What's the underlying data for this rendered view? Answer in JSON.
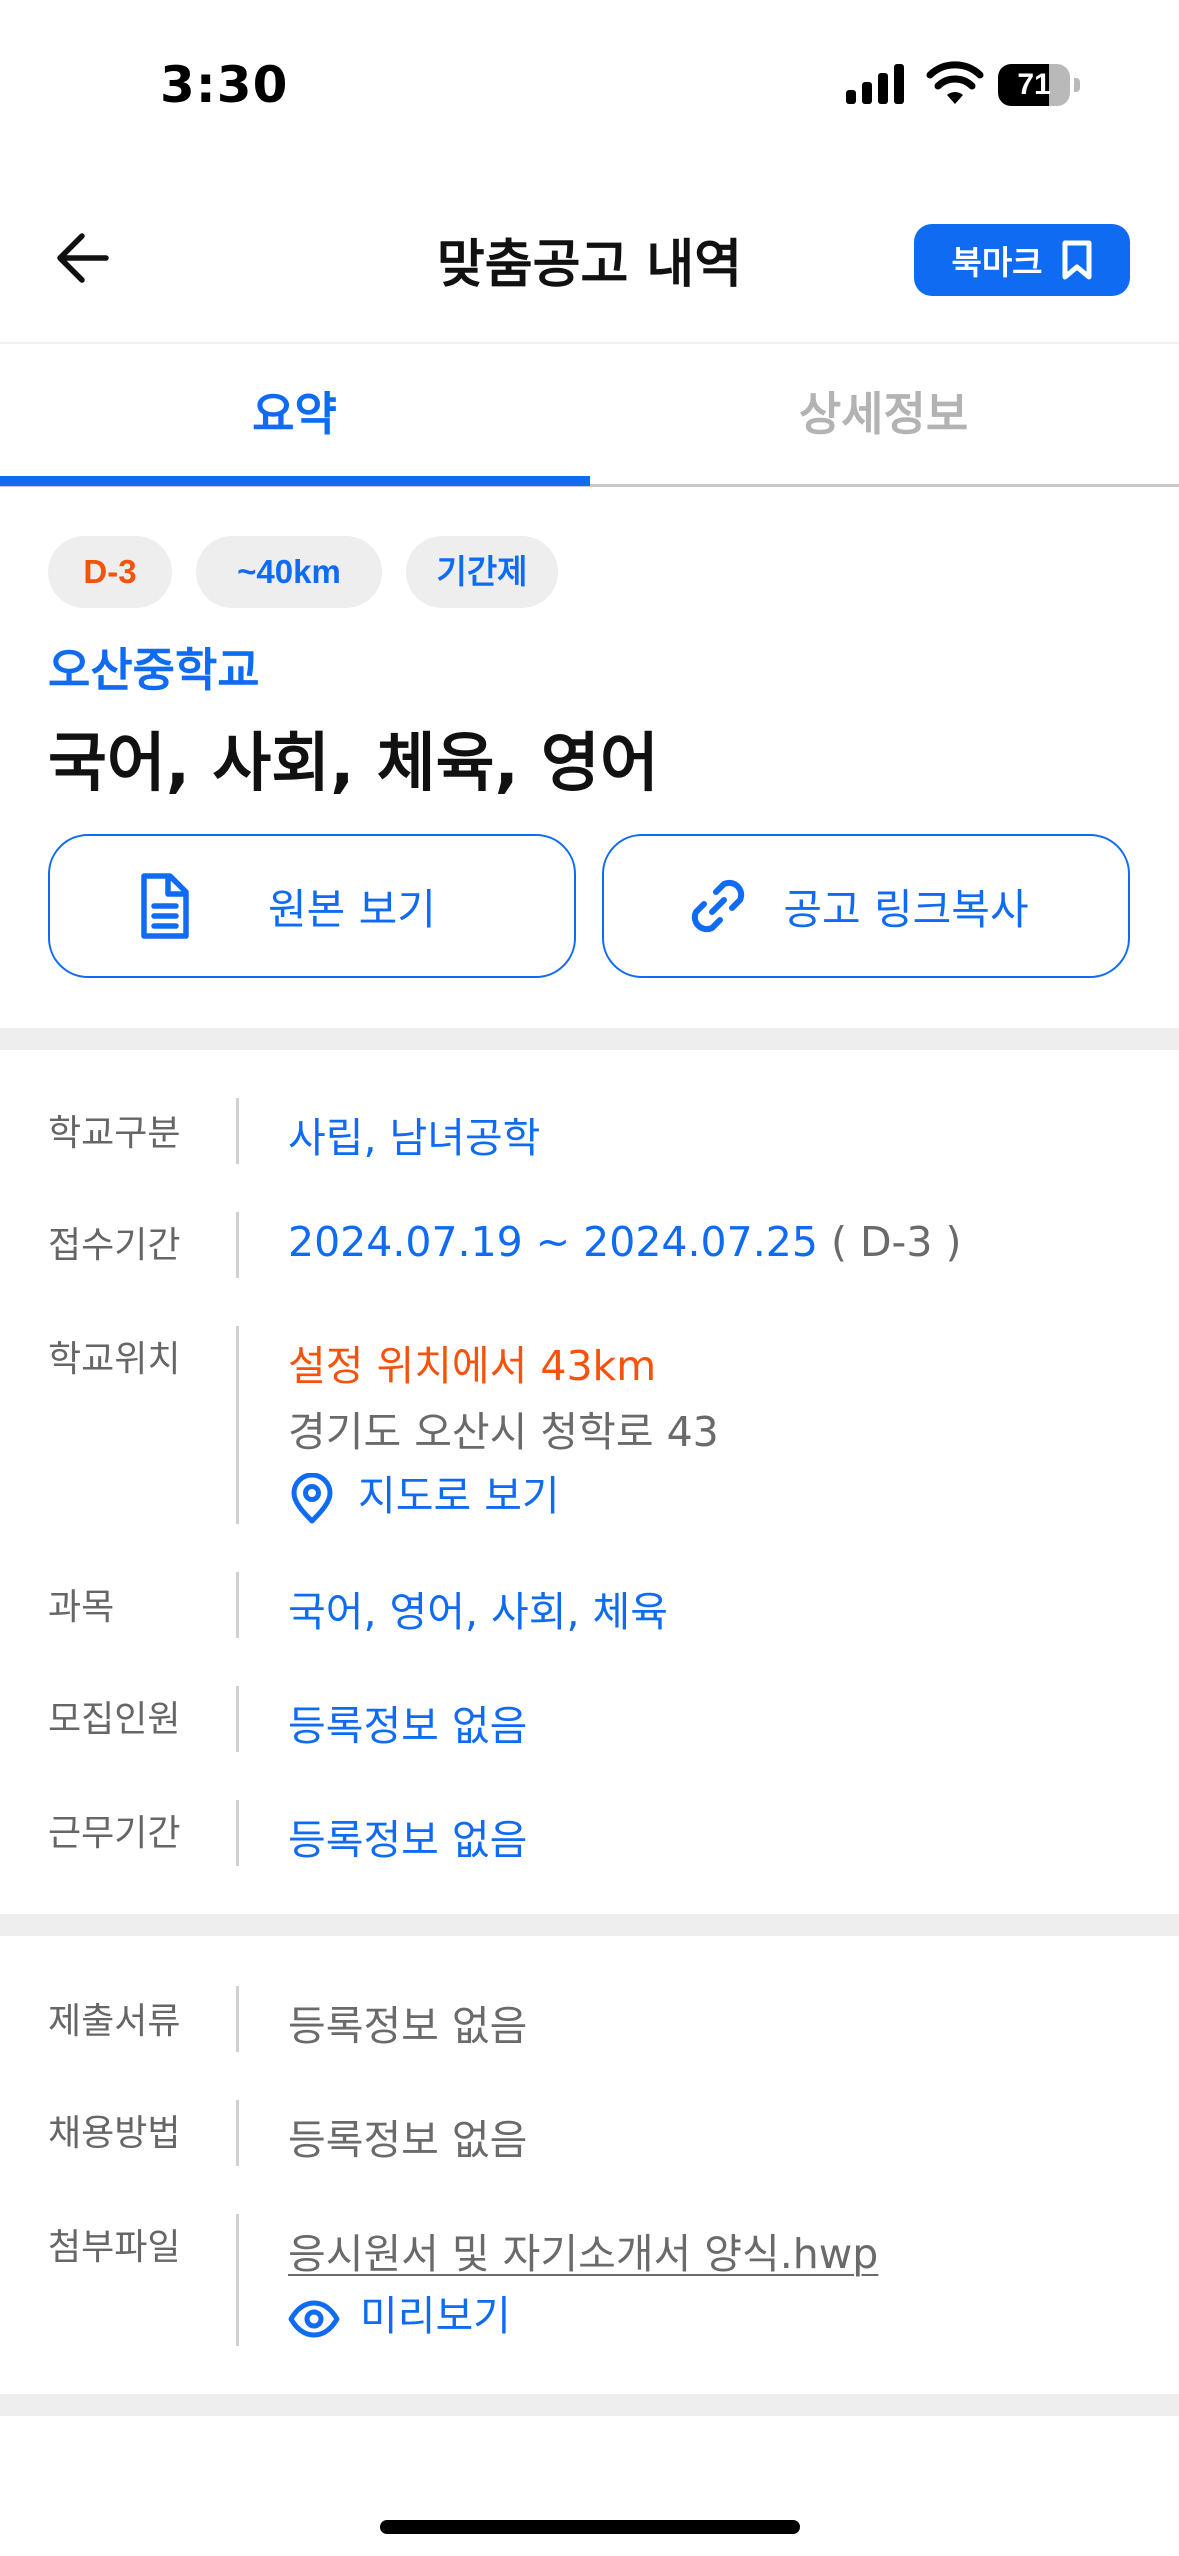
{
  "status_bar": {
    "time": "3:30",
    "battery": "71",
    "battery_level": 0.71
  },
  "header": {
    "title": "맞춤공고 내역",
    "bookmark_label": "북마크"
  },
  "tabs": [
    {
      "label": "요약",
      "active": true
    },
    {
      "label": "상세정보",
      "active": false
    }
  ],
  "chips": {
    "deadline": "D-3",
    "distance": "~40km",
    "type": "기간제"
  },
  "school_name": "오산중학교",
  "subjects_title": "국어, 사회, 체육, 영어",
  "actions": {
    "original": "원본 보기",
    "copy_link": "공고 링크복사"
  },
  "info": {
    "school_type_label": "학교구분",
    "school_type": "사립, 남녀공학",
    "period_label": "접수기간",
    "period": "2024.07.19 ~ 2024.07.25",
    "period_dday": " ( D-3 )",
    "location_label": "학교위치",
    "location_distance": "설정 위치에서 43km",
    "location_address": "경기도 오산시 청학로 43",
    "map_link": "지도로 보기",
    "subjects_label": "과목",
    "subjects": "국어, 영어, 사회, 체육",
    "recruit_label": "모집인원",
    "recruit": "등록정보 없음",
    "work_period_label": "근무기간",
    "work_period": "등록정보 없음"
  },
  "extra": {
    "documents_label": "제출서류",
    "documents": "등록정보 없음",
    "method_label": "채용방법",
    "method": "등록정보 없음",
    "attachment_label": "첨부파일",
    "attachment_file": "응시원서 및 자기소개서 양식.hwp",
    "preview": "미리보기"
  },
  "colors": {
    "accent": "#0f6cf2",
    "warning": "#f5520b",
    "muted": "#6a6a6a"
  }
}
